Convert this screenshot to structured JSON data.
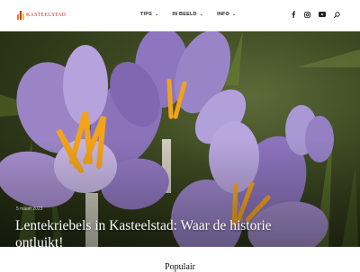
{
  "brand": {
    "name": "KASTEELSTAD",
    "color": "#c0392b"
  },
  "nav": [
    {
      "label": "TIPS"
    },
    {
      "label": "IN BEELD"
    },
    {
      "label": "INFO"
    }
  ],
  "social_icons": [
    "facebook-icon",
    "instagram-icon",
    "youtube-icon",
    "search-icon"
  ],
  "hero": {
    "byline": "5 maart 2023",
    "headline": "Lentekriebels in Kasteelstad: Waar de historie ontluikt!"
  },
  "section": {
    "title": "Populair"
  }
}
